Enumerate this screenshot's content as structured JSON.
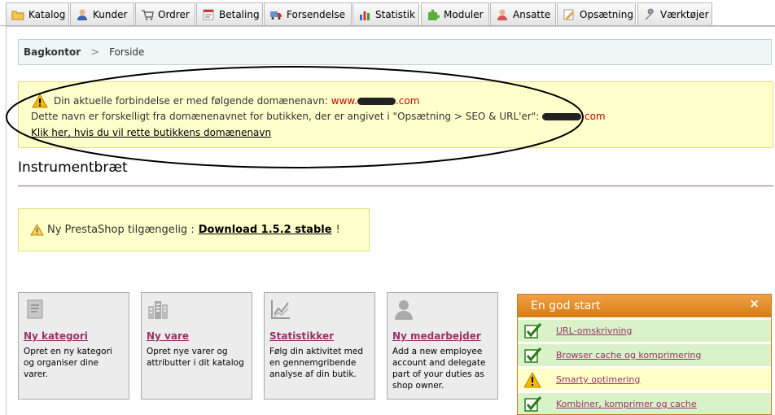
{
  "tabs": [
    {
      "label": "Katalog",
      "icon": "folder-icon"
    },
    {
      "label": "Kunder",
      "icon": "customer-icon"
    },
    {
      "label": "Ordrer",
      "icon": "cart-icon"
    },
    {
      "label": "Betaling",
      "icon": "payment-icon"
    },
    {
      "label": "Forsendelse",
      "icon": "truck-icon"
    },
    {
      "label": "Statistik",
      "icon": "bar-chart-icon"
    },
    {
      "label": "Moduler",
      "icon": "puzzle-icon"
    },
    {
      "label": "Ansatte",
      "icon": "employee-icon"
    },
    {
      "label": "Opsætning",
      "icon": "settings-icon"
    },
    {
      "label": "Værktøjer",
      "icon": "wrench-icon"
    }
  ],
  "breadcrumb": {
    "home": "Bagkontor",
    "separator": ">",
    "current": "Forside"
  },
  "domain_warning": {
    "line1_prefix": "Din aktuelle forbindelse er med følgende domænenavn:",
    "line1_domain_start": "www.",
    "line1_domain_end": ".com",
    "line2_prefix": "Dette navn er forskelligt fra domænenavnet for butikken, der er angivet i \"Opsætning > SEO & URL'er\":",
    "line2_domain_end": ".com",
    "fix_link": "Klik her, hvis du vil rette butikkens domænenavn"
  },
  "dashboard": {
    "title": "Instrumentbræt"
  },
  "update_notice": {
    "prefix": "Ny PrestaShop tilgængelig :",
    "link": "Download 1.5.2 stable",
    "suffix": "!"
  },
  "quick_cards": [
    {
      "title": "Ny kategori",
      "desc": "Opret en ny kategori og organiser dine varer.",
      "icon": "category-icon"
    },
    {
      "title": "Ny vare",
      "desc": "Opret nye varer og attributter i dit katalog",
      "icon": "product-icon"
    },
    {
      "title": "Statistikker",
      "desc": "Følg din aktivitet med en gennemgribende analyse af din butik.",
      "icon": "stats-icon"
    },
    {
      "title": "Ny medarbejder",
      "desc": "Add a new employee account and delegate part of your duties as shop owner.",
      "icon": "employee-icon"
    }
  ],
  "good_start": {
    "title": "En god start",
    "close": "×",
    "items": [
      {
        "label": "URL-omskrivning",
        "status": "ok"
      },
      {
        "label": "Browser cache og komprimering",
        "status": "ok"
      },
      {
        "label": "Smarty optimering",
        "status": "warning"
      },
      {
        "label": "Kombiner, komprimer og cache",
        "status": "ok"
      }
    ]
  },
  "colors": {
    "warning_bg": "#ffffcc",
    "link_purple": "#993366",
    "accent_orange": "#d77c12",
    "ok_green_bg": "#d9f2c7"
  }
}
